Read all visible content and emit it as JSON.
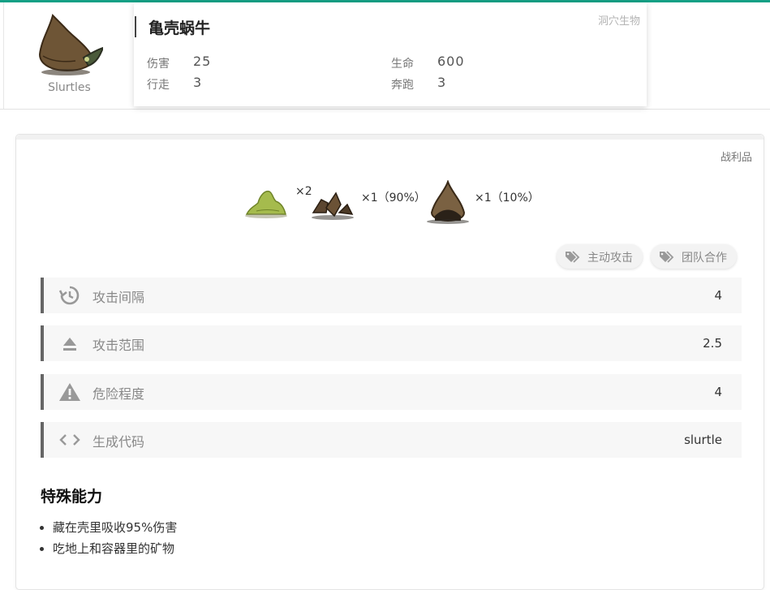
{
  "creature": {
    "name": "亀壳蜗牛",
    "english_name": "Slurtles",
    "category": "洞穴生物",
    "portrait_icon": "slurtle-icon",
    "stats": [
      {
        "label": "伤害",
        "value": "25"
      },
      {
        "label": "生命",
        "value": "600"
      },
      {
        "label": "行走",
        "value": "3"
      },
      {
        "label": "奔跑",
        "value": "3"
      }
    ]
  },
  "loot": {
    "title": "战利品",
    "drops": [
      {
        "icon": "slime-icon",
        "text": "×2"
      },
      {
        "icon": "broken-shell-icon",
        "text": "×1（90%）"
      },
      {
        "icon": "slurtle-helmet-icon",
        "text": "×1（10%）"
      }
    ]
  },
  "tags": [
    {
      "icon": "tag-icon",
      "label": "主动攻击"
    },
    {
      "icon": "tag-icon",
      "label": "团队合作"
    }
  ],
  "attributes": [
    {
      "icon": "clock-icon",
      "label": "攻击间隔",
      "value": "4"
    },
    {
      "icon": "eject-icon",
      "label": "攻击范围",
      "value": "2.5"
    },
    {
      "icon": "warning-icon",
      "label": "危险程度",
      "value": "4"
    },
    {
      "icon": "code-icon",
      "label": "生成代码",
      "value": "slurtle"
    }
  ],
  "abilities": {
    "title": "特殊能力",
    "items": [
      "藏在壳里吸收95%伤害",
      "吃地上和容器里的矿物"
    ]
  },
  "colors": {
    "accent": "#14a085",
    "row_border": "#666666",
    "row_bg": "#f7f7f7"
  }
}
